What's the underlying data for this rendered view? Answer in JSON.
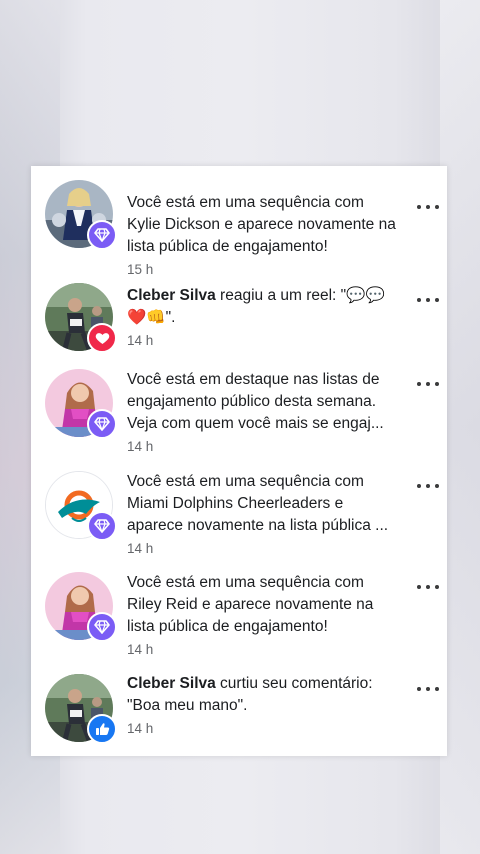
{
  "colors": {
    "purple_badge": "#7b5cf5",
    "red_badge": "#f02849",
    "blue_badge": "#1877f2",
    "time_gray": "#65676b"
  },
  "notifications": [
    {
      "avatar_icon": "cheerleader-photo",
      "badge_icon": "diamond-icon",
      "text": "Você está em uma sequência com Kylie Dickson e aparece novamente na lista pública de engajamento!",
      "time": "15 h"
    },
    {
      "avatar_icon": "runner-photo",
      "badge_icon": "heart-icon",
      "actor": "Cleber Silva",
      "text": " reagiu a um reel: \"💬💬❤️👊\".",
      "time": "14 h"
    },
    {
      "avatar_icon": "woman-photo",
      "badge_icon": "diamond-icon",
      "text": "Você está em destaque nas listas de engajamento público desta semana. Veja com quem você mais se engaj...",
      "time": "14 h"
    },
    {
      "avatar_icon": "dolphins-logo",
      "badge_icon": "diamond-icon",
      "text": "Você está em uma sequência com Miami Dolphins Cheerleaders e aparece novamente na lista pública ...",
      "time": "14 h"
    },
    {
      "avatar_icon": "woman-photo",
      "badge_icon": "diamond-icon",
      "text": "Você está em uma sequência com Riley Reid e aparece novamente na lista pública de engajamento!",
      "time": "14 h"
    },
    {
      "avatar_icon": "runner-photo",
      "badge_icon": "thumbs-up-icon",
      "actor": "Cleber Silva",
      "text": " curtiu seu comentário: \"Boa meu mano\".",
      "time": "14 h"
    }
  ]
}
